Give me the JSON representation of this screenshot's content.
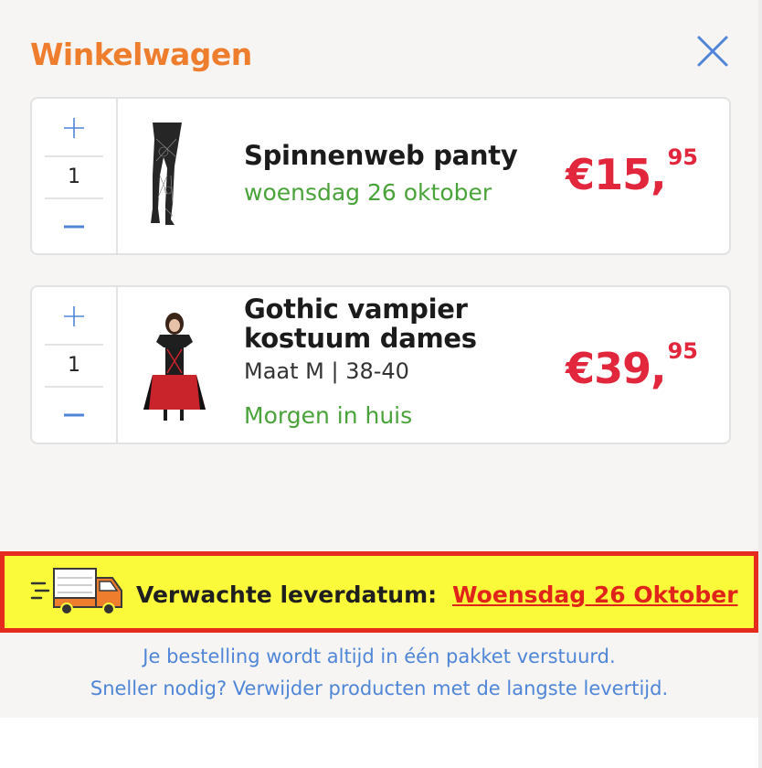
{
  "header": {
    "title": "Winkelwagen",
    "close_icon": "close-icon"
  },
  "cart": {
    "items": [
      {
        "name_lines": [
          "Spinnenweb panty"
        ],
        "delivery": "woensdag 26 oktober",
        "quantity": "1",
        "price_main": "€15,",
        "price_cents": "95",
        "image": "tights-image"
      },
      {
        "name_lines": [
          "Gothic vampier",
          "kostuum dames"
        ],
        "size": "Maat M | 38-40",
        "delivery": "Morgen in huis",
        "quantity": "1",
        "price_main": "€39,",
        "price_cents": "95",
        "image": "costume-image"
      }
    ]
  },
  "banner": {
    "label": "Verwachte leverdatum:",
    "date": " Woensdag 26 Oktober",
    "icon": "delivery-truck-icon"
  },
  "info": {
    "line1": "Je bestelling wordt altijd in één pakket verstuurd.",
    "line2": "Sneller nodig? Verwijder producten met de langste levertijd."
  },
  "colors": {
    "title": "#ef7d2e",
    "price": "#e2273d",
    "delivery_green": "#4aa33a",
    "banner_bg": "#fbfa3a",
    "banner_border": "#e52b1e",
    "info_blue": "#4f86d8",
    "icon_blue": "#4f86d8"
  }
}
